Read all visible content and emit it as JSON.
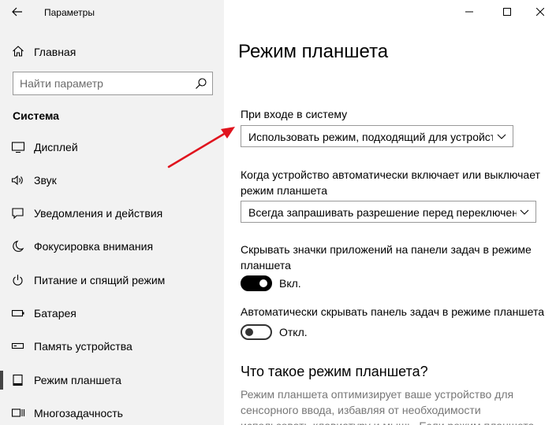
{
  "window": {
    "title": "Параметры"
  },
  "sidebar": {
    "home_label": "Главная",
    "search_placeholder": "Найти параметр",
    "section_label": "Система",
    "items": [
      {
        "label": "Дисплей",
        "icon": "display-icon"
      },
      {
        "label": "Звук",
        "icon": "sound-icon"
      },
      {
        "label": "Уведомления и действия",
        "icon": "notifications-icon"
      },
      {
        "label": "Фокусировка внимания",
        "icon": "moon-icon"
      },
      {
        "label": "Питание и спящий режим",
        "icon": "power-icon"
      },
      {
        "label": "Батарея",
        "icon": "battery-icon"
      },
      {
        "label": "Память устройства",
        "icon": "storage-icon"
      },
      {
        "label": "Режим планшета",
        "icon": "tablet-icon",
        "active": true
      },
      {
        "label": "Многозадачность",
        "icon": "multitasking-icon"
      }
    ]
  },
  "main": {
    "title": "Режим планшета",
    "signin_label": "При входе в систему",
    "signin_value": "Использовать режим, подходящий для устройства",
    "auto_switch_label": "Когда устройство автоматически включает или выключает режим планшета",
    "auto_switch_value": "Всегда запрашивать разрешение перед переключени...",
    "hide_icons_label": "Скрывать значки приложений на панели задач в режиме планшета",
    "hide_icons_state": "Вкл.",
    "hide_icons_on": true,
    "hide_taskbar_label": "Автоматически скрывать панель задач в режиме планшета",
    "hide_taskbar_state": "Откл.",
    "hide_taskbar_on": false,
    "what_is_heading": "Что такое режим планшета?",
    "what_is_text": "Режим планшета оптимизирует ваше устройство для сенсорного ввода, избавляя от необходимости использовать клавиатуру и мышь. Если режим планшета"
  },
  "colors": {
    "sidebar_bg": "#f2f2f2",
    "annotation_arrow": "#e0141e",
    "toggle_on": "#000000",
    "description_text": "#777777"
  }
}
